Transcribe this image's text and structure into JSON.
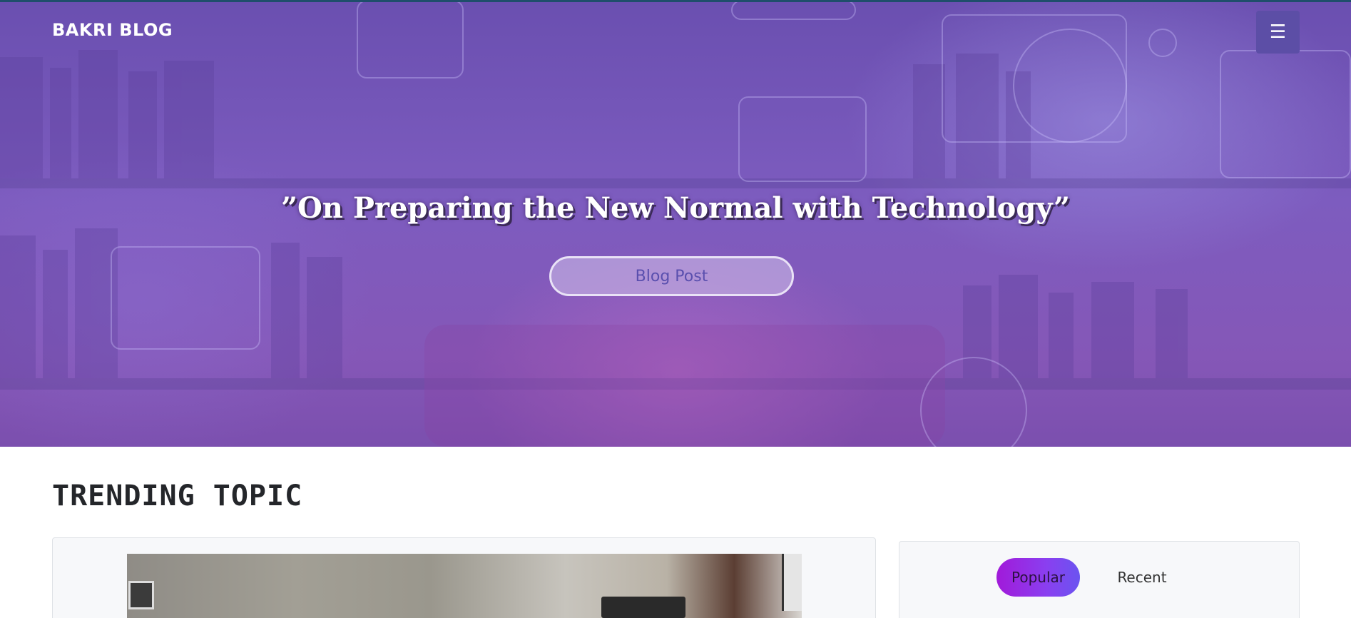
{
  "navbar": {
    "brand": "BAKRI BLOG",
    "menu_icon": "hamburger-menu-icon",
    "menu_glyph": "☰"
  },
  "hero": {
    "headline": "”On Preparing the New Normal with Technology”",
    "button_label": "Blog Post"
  },
  "trending": {
    "title": "TRENDING TOPIC"
  },
  "sidebar": {
    "tabs": [
      {
        "label": "Popular",
        "active": true
      },
      {
        "label": "Recent",
        "active": false
      }
    ]
  },
  "colors": {
    "hero_overlay": "#7d5cbf",
    "menu_button": "#5c4ea6",
    "active_tab_gradient_start": "#a11ad9",
    "active_tab_gradient_end": "#6b54f0",
    "section_title": "#24262a"
  }
}
